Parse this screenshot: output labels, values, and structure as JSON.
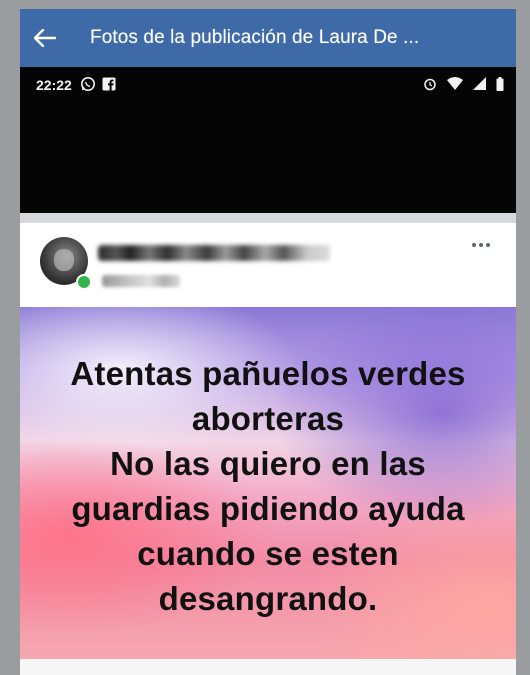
{
  "header": {
    "title": "Fotos de la publicación de Laura De ...",
    "back_icon": "arrow-left-icon"
  },
  "status_bar": {
    "time": "22:22",
    "left_icons": [
      "whatsapp-icon",
      "facebook-icon"
    ],
    "right_icons": [
      "alarm-icon",
      "wifi-icon",
      "signal-icon",
      "battery-icon"
    ]
  },
  "post": {
    "author_name": "",
    "meta": "",
    "image_text": [
      "Atentas pañuelos verdes",
      "aborteras",
      "No las quiero en las",
      "guardias pidiendo ayuda",
      "cuando se esten",
      "desangrando."
    ]
  },
  "colors": {
    "header_bg": "#3f6aa8",
    "online_dot": "#34b54a"
  }
}
